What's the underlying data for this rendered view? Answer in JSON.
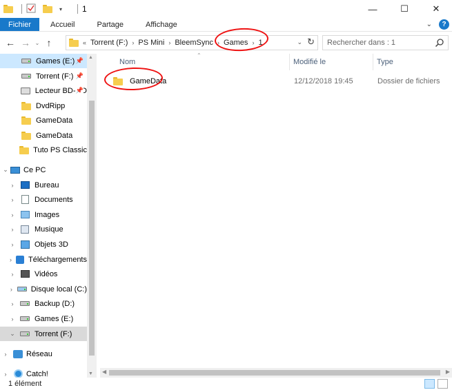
{
  "window": {
    "title": "1",
    "minimize": "—",
    "maximize": "☐",
    "close": "✕"
  },
  "ribbon": {
    "tabs": [
      "Fichier",
      "Accueil",
      "Partage",
      "Affichage"
    ],
    "help": "?",
    "expand": "⌄"
  },
  "address": {
    "overflow": "«",
    "crumbs": [
      "Torrent (F:)",
      "PS Mini",
      "BleemSync",
      "Games",
      "1"
    ],
    "separator": "›",
    "dropdown": "⌄",
    "refresh": "↻"
  },
  "search": {
    "placeholder": "Rechercher dans : 1"
  },
  "nav": {
    "quick_access": [
      {
        "label": "Games (E:)",
        "icon": "drive-icon",
        "pinned": true
      },
      {
        "label": "Torrent (F:)",
        "icon": "drive-icon",
        "pinned": true
      },
      {
        "label": "Lecteur BD-RO",
        "icon": "disc-icon",
        "pinned": true
      },
      {
        "label": "DvdRipp",
        "icon": "folder-icon"
      },
      {
        "label": "GameData",
        "icon": "folder-icon"
      },
      {
        "label": "GameData",
        "icon": "folder-icon"
      },
      {
        "label": "Tuto PS Classic",
        "icon": "folder-icon"
      }
    ],
    "this_pc": "Ce PC",
    "pc_items": [
      {
        "label": "Bureau",
        "icon": "desktop-icon"
      },
      {
        "label": "Documents",
        "icon": "documents-icon"
      },
      {
        "label": "Images",
        "icon": "images-icon"
      },
      {
        "label": "Musique",
        "icon": "music-icon"
      },
      {
        "label": "Objets 3D",
        "icon": "objects-3d-icon"
      },
      {
        "label": "Téléchargements",
        "icon": "downloads-icon"
      },
      {
        "label": "Vidéos",
        "icon": "videos-icon"
      },
      {
        "label": "Disque local (C:)",
        "icon": "drive-icon"
      },
      {
        "label": "Backup (D:)",
        "icon": "drive-icon"
      },
      {
        "label": "Games (E:)",
        "icon": "drive-icon"
      },
      {
        "label": "Torrent (F:)",
        "icon": "drive-icon"
      }
    ],
    "network": "Réseau",
    "catch": "Catch!"
  },
  "columns": {
    "name": "Nom",
    "modified": "Modifié le",
    "type": "Type"
  },
  "files": [
    {
      "name": "GameData",
      "modified": "12/12/2018 19:45",
      "type": "Dossier de fichiers"
    }
  ],
  "status": {
    "count": "1 élément"
  }
}
